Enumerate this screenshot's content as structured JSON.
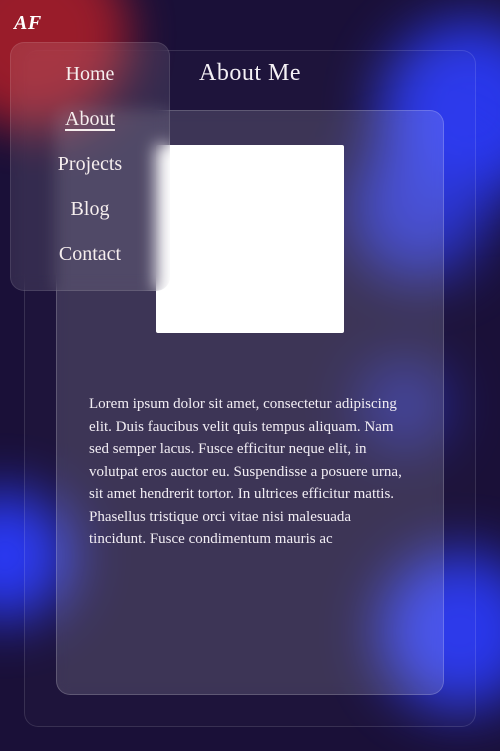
{
  "logo": "AF",
  "page_title": "About Me",
  "nav": {
    "items": [
      {
        "label": "Home"
      },
      {
        "label": "About"
      },
      {
        "label": "Projects"
      },
      {
        "label": "Blog"
      },
      {
        "label": "Contact"
      }
    ],
    "active_index": 1
  },
  "about": {
    "bio": "Lorem ipsum dolor sit amet, consectetur adipiscing elit. Duis faucibus velit quis tempus aliquam. Nam sed semper lacus. Fusce efficitur neque elit, in volutpat eros auctor eu. Suspendisse a posuere urna, sit amet hendrerit tortor. In ultrices efficitur mattis. Phasellus tristique orci vitae nisi malesuada tincidunt. Fusce condimentum mauris ac"
  }
}
